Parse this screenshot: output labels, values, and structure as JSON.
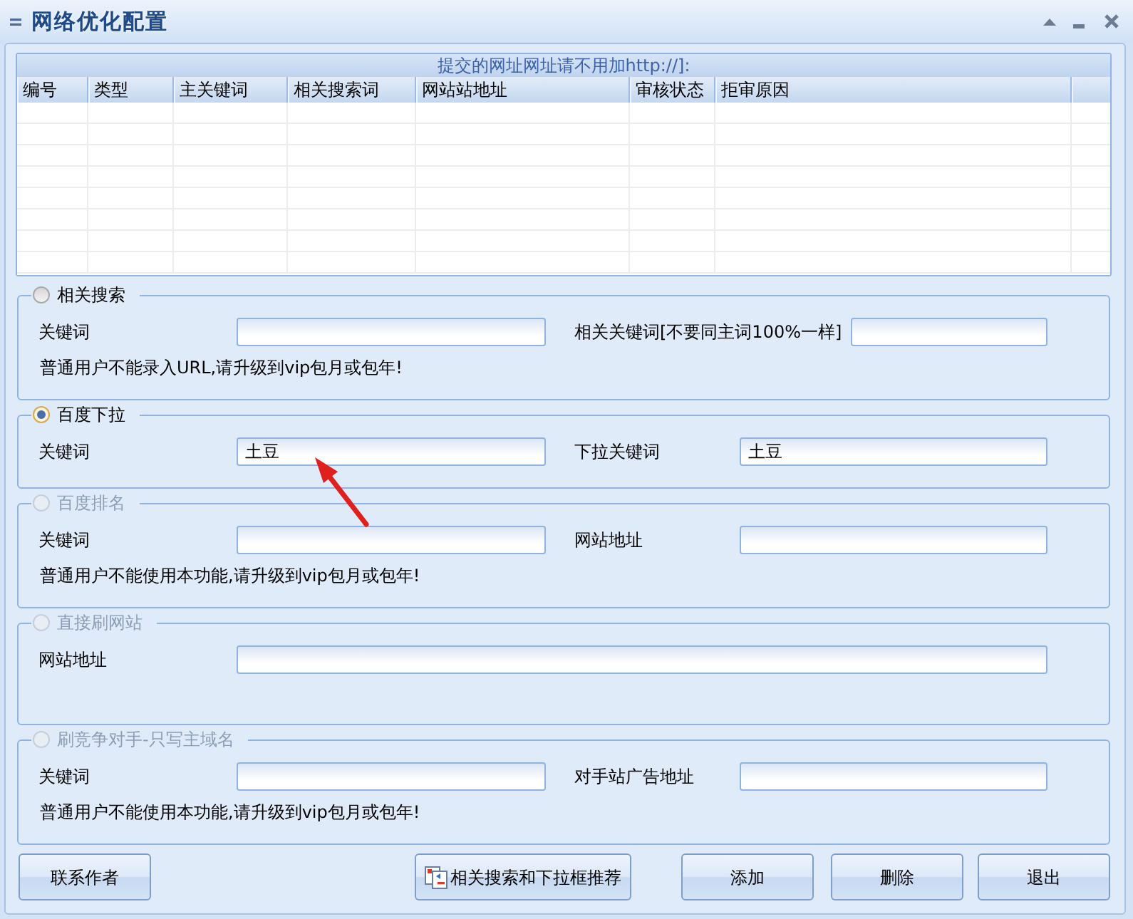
{
  "window": {
    "title": "网络优化配置"
  },
  "table": {
    "caption": "提交的网址网址请不用加http://]:",
    "columns": [
      "编号",
      "类型",
      "主关键词",
      "相关搜索词",
      "网站站地址",
      "审核状态",
      "拒审原因"
    ]
  },
  "sections": [
    {
      "title": "相关搜索",
      "selected": false,
      "disabled": false,
      "fields": [
        {
          "label": "关键词"
        },
        {
          "label": "相关关键词[不要同主词100%一样]"
        }
      ],
      "note": "普通用户不能录入URL,请升级到vip包月或包年!"
    },
    {
      "title": "百度下拉",
      "selected": true,
      "disabled": false,
      "fields": [
        {
          "label": "关键词",
          "value": "土豆"
        },
        {
          "label": "下拉关键词",
          "value": "土豆"
        }
      ]
    },
    {
      "title": "百度排名",
      "selected": false,
      "disabled": true,
      "fields": [
        {
          "label": "关键词"
        },
        {
          "label": "网站地址"
        }
      ],
      "note": "普通用户不能使用本功能,请升级到vip包月或包年!"
    },
    {
      "title": "直接刷网站",
      "selected": false,
      "disabled": true,
      "fields": [
        {
          "label": "网站地址"
        }
      ]
    },
    {
      "title": "刷竞争对手-只写主域名",
      "selected": false,
      "disabled": true,
      "fields": [
        {
          "label": "关键词"
        },
        {
          "label": "对手站广告地址"
        }
      ],
      "note": "普通用户不能使用本功能,请升级到vip包月或包年!"
    }
  ],
  "buttons": [
    {
      "label": "联系作者",
      "kind": "plain"
    },
    {
      "label": "相关搜索和下拉框推荐",
      "kind": "icon"
    },
    {
      "label": "添加",
      "kind": "plain"
    },
    {
      "label": "删除",
      "kind": "plain"
    },
    {
      "label": "退出",
      "kind": "plain"
    }
  ]
}
